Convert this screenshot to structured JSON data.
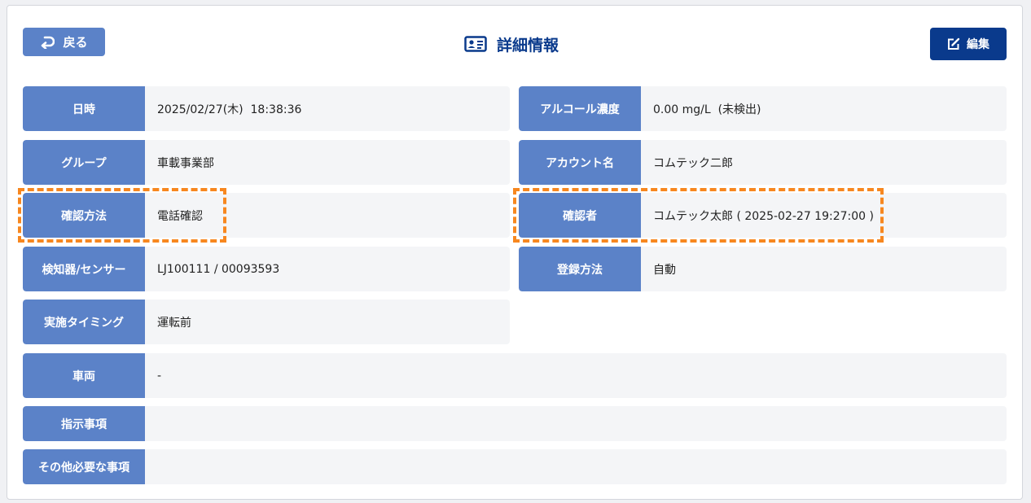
{
  "header": {
    "back_label": "戻る",
    "title": "詳細情報",
    "edit_label": "編集"
  },
  "fields": {
    "datetime": {
      "label": "日時",
      "value": "2025/02/27(木)  18:38:36"
    },
    "alcohol": {
      "label": "アルコール濃度",
      "value": "0.00 mg/L  (未検出)"
    },
    "group": {
      "label": "グループ",
      "value": "車載事業部"
    },
    "account": {
      "label": "アカウント名",
      "value": "コムテック二郎"
    },
    "confirm_method": {
      "label": "確認方法",
      "value": "電話確認"
    },
    "confirmer": {
      "label": "確認者",
      "value": "コムテック太郎 ( 2025-02-27 19:27:00 )"
    },
    "detector": {
      "label": "検知器/センサー",
      "value": "LJ100111 / 00093593"
    },
    "register_method": {
      "label": "登録方法",
      "value": "自動"
    },
    "timing": {
      "label": "実施タイミング",
      "value": "運転前"
    },
    "vehicle": {
      "label": "車両",
      "value": "-"
    },
    "instructions": {
      "label": "指示事項",
      "value": ""
    },
    "other": {
      "label": "その他必要な事項",
      "value": ""
    }
  },
  "colors": {
    "label_bg": "#5b82c8",
    "primary": "#0a3a8c",
    "highlight": "#f7871f"
  },
  "icons": {
    "back": "return-arrow-icon",
    "title": "id-card-icon",
    "edit": "edit-icon"
  }
}
